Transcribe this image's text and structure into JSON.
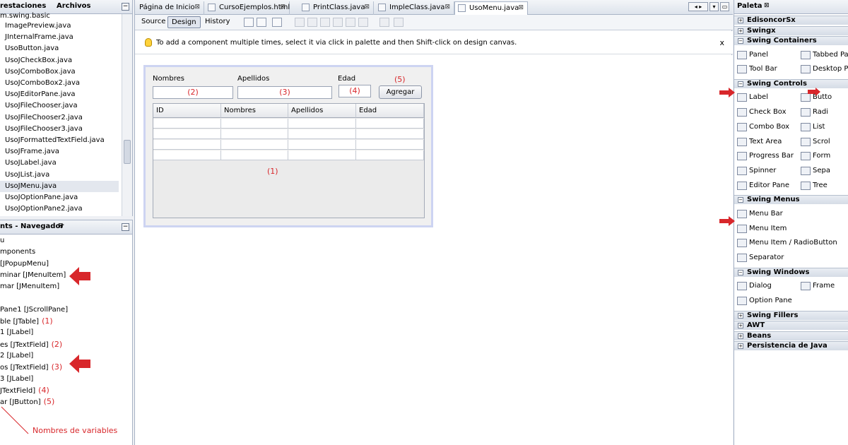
{
  "left_top": {
    "tabs": [
      "restaciones",
      "Archivos"
    ],
    "path": "m.swing.basic",
    "files": [
      "ImagePreview.java",
      "JInternalFrame.java",
      "UsoButton.java",
      "UsoJCheckBox.java",
      "UsoJComboBox.java",
      "UsoJComboBox2.java",
      "UsoJEditorPane.java",
      "UsoJFileChooser.java",
      "UsoJFileChooser2.java",
      "UsoJFileChooser3.java",
      "UsoJFormattedTextField.java",
      "UsoJFrame.java",
      "UsoJLabel.java",
      "UsoJList.java",
      "UsoJMenu.java",
      "UsoJOptionPane.java",
      "UsoJOptionPane2.java"
    ],
    "selected_file": "UsoJMenu.java"
  },
  "left_bottom": {
    "title": "nts - Navegador",
    "close": "⊠",
    "rows": [
      {
        "text": "u",
        "note": ""
      },
      {
        "text": "mponents",
        "note": ""
      },
      {
        "text": " [JPopupMenu]",
        "note": ""
      },
      {
        "text": "minar [JMenuItem]",
        "note": ""
      },
      {
        "text": "mar [JMenuItem]",
        "note": ""
      },
      {
        "text": "",
        "note": ""
      },
      {
        "text": "Pane1 [JScrollPane]",
        "note": ""
      },
      {
        "text": "ble [JTable]",
        "note": "(1)"
      },
      {
        "text": "1 [JLabel]",
        "note": ""
      },
      {
        "text": "es [JTextField]",
        "note": "(2)"
      },
      {
        "text": "2 [JLabel]",
        "note": ""
      },
      {
        "text": "os [JTextField]",
        "note": "(3)"
      },
      {
        "text": "3 [JLabel]",
        "note": ""
      },
      {
        "text": "JTextField]",
        "note": "(4)"
      },
      {
        "text": "ar [JButton]",
        "note": "(5)"
      }
    ],
    "annotation": "Nombres de variables"
  },
  "editor": {
    "tabs": [
      {
        "label": "Página de Inicio",
        "active": false
      },
      {
        "label": "CursoEjemplos.html",
        "active": false
      },
      {
        "label": "PrintClass.java",
        "active": false
      },
      {
        "label": "ImpleClass.java",
        "active": false
      },
      {
        "label": "UsoMenu.java",
        "active": true
      }
    ],
    "tab_close": "⊠",
    "views": [
      "Source",
      "Design",
      "History"
    ],
    "active_view": "Design",
    "info_text": "To add a component multiple times, select it via click in palette and then Shift-click on design canvas.",
    "info_close": "x"
  },
  "form": {
    "labels": {
      "nombres": "Nombres",
      "apellidos": "Apellidos",
      "edad": "Edad",
      "btn_note": "(5)"
    },
    "fields": {
      "nombres": "(2)",
      "apellidos": "(3)",
      "edad": "(4)"
    },
    "button": "Agregar",
    "table_headers": [
      "ID",
      "Nombres",
      "Apellidos",
      "Edad"
    ],
    "table_note": "(1)"
  },
  "palette": {
    "title": "Paleta",
    "close": "⊠",
    "sections": [
      {
        "name": "EdisoncorSx",
        "open": false,
        "items": []
      },
      {
        "name": "Swingx",
        "open": false,
        "items": []
      },
      {
        "name": "Swing Containers",
        "open": true,
        "items": [
          [
            "Panel",
            "Tabbed Pan"
          ],
          [
            "Tool Bar",
            "Desktop Par"
          ]
        ]
      },
      {
        "name": "Swing Controls",
        "open": true,
        "items": [
          [
            "Label",
            "Butto"
          ],
          [
            "Check Box",
            "Radi"
          ],
          [
            "Combo Box",
            "List"
          ],
          [
            "Text Area",
            "Scrol"
          ],
          [
            "Progress Bar",
            "Form"
          ],
          [
            "Spinner",
            "Sepa"
          ],
          [
            "Editor Pane",
            "Tree"
          ]
        ]
      },
      {
        "name": "Swing Menus",
        "open": true,
        "items": [
          [
            "Menu Bar",
            ""
          ],
          [
            "Menu Item",
            ""
          ],
          [
            "Menu Item / RadioButton",
            ""
          ],
          [
            "Separator",
            ""
          ]
        ]
      },
      {
        "name": "Swing Windows",
        "open": true,
        "items": [
          [
            "Dialog",
            "Frame"
          ],
          [
            "Option Pane",
            ""
          ]
        ]
      },
      {
        "name": "Swing Fillers",
        "open": false,
        "items": []
      },
      {
        "name": "AWT",
        "open": false,
        "items": []
      },
      {
        "name": "Beans",
        "open": false,
        "items": []
      },
      {
        "name": "Persistencia de Java",
        "open": false,
        "items": []
      }
    ]
  },
  "colors": {
    "annotation_red": "#d8272b",
    "form_border": "#cdd4f2"
  }
}
